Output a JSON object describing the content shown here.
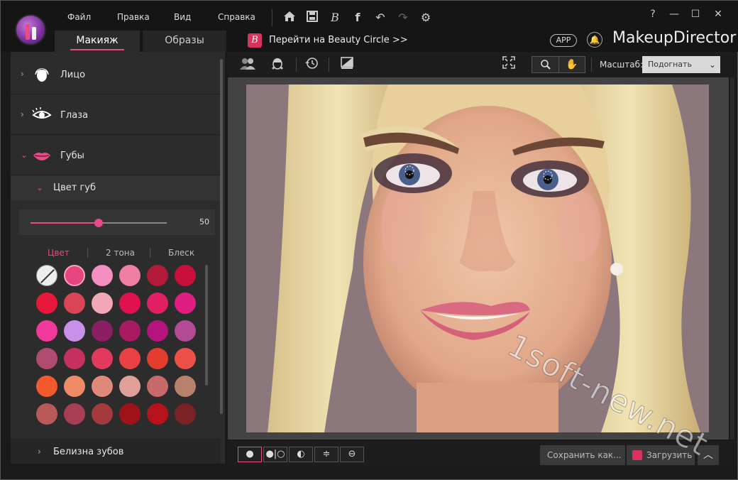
{
  "menu": {
    "file": "Файл",
    "edit": "Правка",
    "view": "Вид",
    "help": "Справка"
  },
  "tabs": {
    "makeup": "Макияж",
    "looks": "Образы"
  },
  "beauty_circle": {
    "icon_letter": "B",
    "link": "Перейти на Beauty Circle >>"
  },
  "header_right": {
    "app_badge": "APP",
    "brand_normal": "Makeup",
    "brand_bold": "Director"
  },
  "window": {
    "help": "?",
    "minimize": "—",
    "maximize": "☐",
    "close": "✕"
  },
  "categories": {
    "face": "Лицо",
    "eyes": "Глаза",
    "lips": "Губы",
    "lip_color": "Цвет губ",
    "teeth": "Белизна зубов"
  },
  "slider": {
    "value": 50,
    "value_label": "50"
  },
  "subtabs": {
    "color": "Цвет",
    "two_tone": "2 тона",
    "gloss": "Блеск"
  },
  "swatches": [
    "none",
    "#e6457d",
    "#f58ec2",
    "#ee7fa2",
    "#b21a3a",
    "#c8103a",
    "#e8183a",
    "#d94457",
    "#f2a7b8",
    "#e0114f",
    "#e12063",
    "#e01e82",
    "#f0399b",
    "#c890e8",
    "#8a1f63",
    "#a81a62",
    "#b5137e",
    "#b24a96",
    "#b04c70",
    "#c6305e",
    "#e23a5e",
    "#e94046",
    "#e23d2f",
    "#ec5049",
    "#f25a2e",
    "#ee8a66",
    "#e08a7a",
    "#e0a098",
    "#c86a6a",
    "#b8826a",
    "#b85a58",
    "#a83e52",
    "#a33a3c",
    "#a0121a",
    "#b6121a",
    "#7a2226"
  ],
  "toolbar": {
    "scale_label": "Масштаб:",
    "scale_value": "Подогнать"
  },
  "bottom": {
    "save": "Сохранить как...",
    "upload": "Загрузить на..."
  },
  "watermark": "1soft-new.net"
}
